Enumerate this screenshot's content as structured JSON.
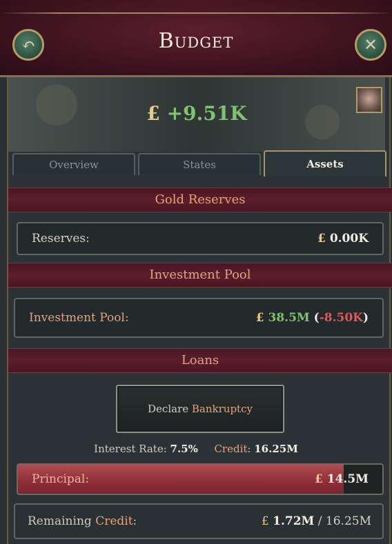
{
  "header": {
    "title": "Budget"
  },
  "balance": {
    "currency": "£",
    "amount": "+9.51K"
  },
  "tabs": [
    {
      "label": "Overview"
    },
    {
      "label": "States"
    },
    {
      "label": "Assets",
      "active": true
    }
  ],
  "gold_reserves": {
    "heading": "Gold Reserves",
    "label": "Reserves:",
    "currency": "£",
    "value": "0.00K"
  },
  "investment_pool": {
    "heading": "Investment Pool",
    "label": "Investment Pool:",
    "currency": "£",
    "value": "38.5M",
    "open_paren": "(",
    "change": "-8.50K",
    "close_paren": ")"
  },
  "loans": {
    "heading": "Loans",
    "bankruptcy_prefix": "Declare",
    "bankruptcy_highlight": "Bankruptcy",
    "interest_label": "Interest Rate:",
    "interest_value": "7.5%",
    "credit_label": "Credit",
    "credit_colon": ":",
    "credit_value": "16.25M",
    "principal_label": "Principal:",
    "principal_currency": "£",
    "principal_value": "14.5M",
    "principal_fraction": 0.893,
    "remaining_prefix": "Remaining",
    "remaining_highlight": "Credit",
    "remaining_colon": ":",
    "remaining_currency": "£",
    "remaining_value": "1.72M",
    "remaining_separator": " / ",
    "remaining_total": "16.25M"
  },
  "colors": {
    "accent_orange": "#e8a27a",
    "positive": "#7fc270",
    "negative": "#e2575a",
    "section_red": "#5c1e2c"
  },
  "icons": {
    "back": "back-arrow-icon",
    "close": "close-icon",
    "portrait": "portrait-icon"
  }
}
